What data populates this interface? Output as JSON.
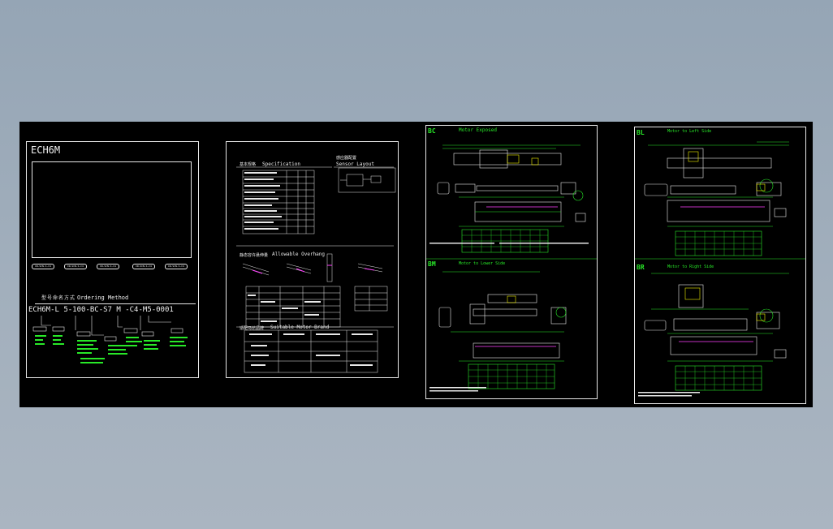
{
  "sheet1": {
    "title": "ECH6M",
    "buttons": [
      "CN-SCN-S-C4",
      "CN-SCN-S-C4",
      "CN-SCN-S-C4",
      "CN-SCN-S-C4",
      "CN-SCN-S-C4"
    ],
    "ordering_cn": "型号命名方式",
    "ordering_en": "Ordering Method",
    "model_code": "ECH6M-L 5-100-BC-S7 M -C4-M5-0001"
  },
  "sheet2": {
    "spec_cn": "基本规格",
    "spec_en": "Specification",
    "sensor_cn": "感应器配置",
    "sensor_en": "Sensor Layout",
    "overhang_cn": "静态容许悬伸量",
    "overhang_en": "Allowable Overhang",
    "motor_cn": "适配马达品牌",
    "motor_en": "Suitable Motor Brand"
  },
  "sheet3": {
    "tag_top": "BC",
    "title_top": "Motor Exposed",
    "tag_bottom": "BM",
    "title_bottom": "Motor to Lower Side"
  },
  "sheet4": {
    "tag_top": "BL",
    "title_top": "Motor to Left Side",
    "tag_bottom": "BR",
    "title_bottom": "Motor to Right Side"
  },
  "colors": {
    "background": "#a0adba",
    "canvas": "#000000",
    "line": "#e8e8e8",
    "accent_green": "#28e828",
    "accent_magenta": "#ff40ff",
    "accent_yellow": "#f0f000"
  }
}
